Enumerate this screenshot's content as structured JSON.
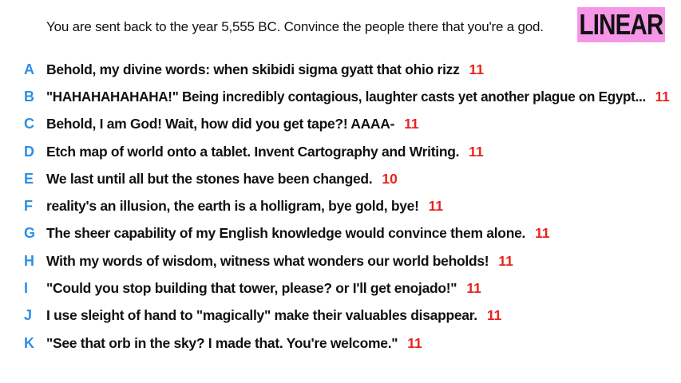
{
  "header": {
    "prompt": "You are sent back to the year 5,555 BC. Convince the people there that you're a god.",
    "mode_badge": "LINEAR"
  },
  "colors": {
    "letter": "#2d8ee8",
    "score": "#e8231c",
    "badge_bg": "#f596e6",
    "text": "#111111"
  },
  "answers": [
    {
      "letter": "A",
      "text": "Behold, my divine words: when skibidi sigma gyatt that ohio rizz",
      "score": "11"
    },
    {
      "letter": "B",
      "text": "\"HAHAHAHAHAHA!\" Being incredibly contagious, laughter casts yet another plague on Egypt...",
      "score": "11"
    },
    {
      "letter": "C",
      "text": "Behold, I am God! Wait, how did you get tape?! AAAA-",
      "score": "11"
    },
    {
      "letter": "D",
      "text": "Etch map of world onto a tablet. Invent Cartography and Writing.",
      "score": "11"
    },
    {
      "letter": "E",
      "text": "We last until all but the stones have been changed.",
      "score": "10"
    },
    {
      "letter": "F",
      "text": "reality's an illusion, the earth is a holligram, bye gold, bye!",
      "score": "11"
    },
    {
      "letter": "G",
      "text": "The sheer capability of my English knowledge would convince them alone.",
      "score": "11"
    },
    {
      "letter": "H",
      "text": "With my words of wisdom, witness what wonders our world beholds!",
      "score": "11"
    },
    {
      "letter": "I",
      "text": "\"Could you stop building that tower, please? or I'll get enojado!\"",
      "score": "11"
    },
    {
      "letter": "J",
      "text": "I use sleight of hand to \"magically\" make their valuables disappear.",
      "score": "11"
    },
    {
      "letter": "K",
      "text": "\"See that orb in the sky? I made that. You're welcome.\"",
      "score": "11"
    }
  ]
}
